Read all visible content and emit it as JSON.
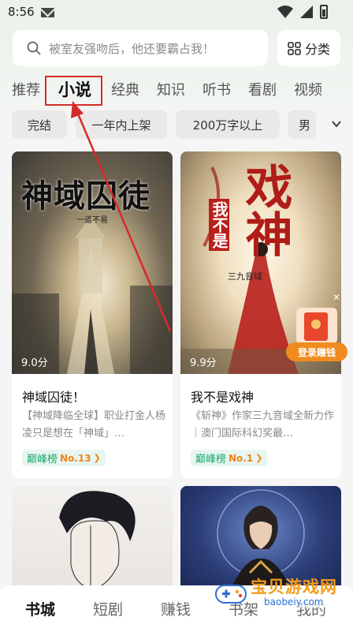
{
  "status_bar": {
    "time": "8:56"
  },
  "search": {
    "placeholder": "被室友强吻后，他还要霸占我！"
  },
  "category_button": {
    "label": "分类"
  },
  "tabs": [
    {
      "label": "推荐"
    },
    {
      "label": "小说"
    },
    {
      "label": "经典"
    },
    {
      "label": "知识"
    },
    {
      "label": "听书"
    },
    {
      "label": "看剧"
    },
    {
      "label": "视频"
    }
  ],
  "active_tab": "小说",
  "filters": [
    {
      "label": "完结"
    },
    {
      "label": "一年内上架"
    },
    {
      "label": "200万字以上"
    },
    {
      "label": "男"
    }
  ],
  "books": [
    {
      "cover_text": "神域囚徒",
      "cover_author": "一道不易",
      "rating": "9.0分",
      "title": "神域囚徒！",
      "desc": "【神域降临全球】职业打金人杨凌只是想在「神域」…",
      "rank_label": "巅峰榜",
      "rank_no": "No.13"
    },
    {
      "cover_text_small": "我不是",
      "cover_text_big": "戏神",
      "cover_author": "三九音域",
      "rating": "9.9分",
      "title": "我不是戏神",
      "desc": "《斩神》作家三九音域全新力作｜澳门国际科幻奖最…",
      "rank_label": "巅峰榜",
      "rank_no": "No.1"
    }
  ],
  "promo": {
    "login_earn": "登录赚钱"
  },
  "bottom_nav": [
    {
      "label": "书城"
    },
    {
      "label": "短剧"
    },
    {
      "label": "赚钱"
    },
    {
      "label": "书架"
    },
    {
      "label": "我的"
    }
  ],
  "watermark": {
    "text": "宝贝游戏网",
    "url": "baobeiy.com"
  },
  "colors": {
    "accent_red": "#d62b2b",
    "rank_green": "#19a86a",
    "rank_orange": "#f08418",
    "earn_orange": "#f08c1e"
  }
}
